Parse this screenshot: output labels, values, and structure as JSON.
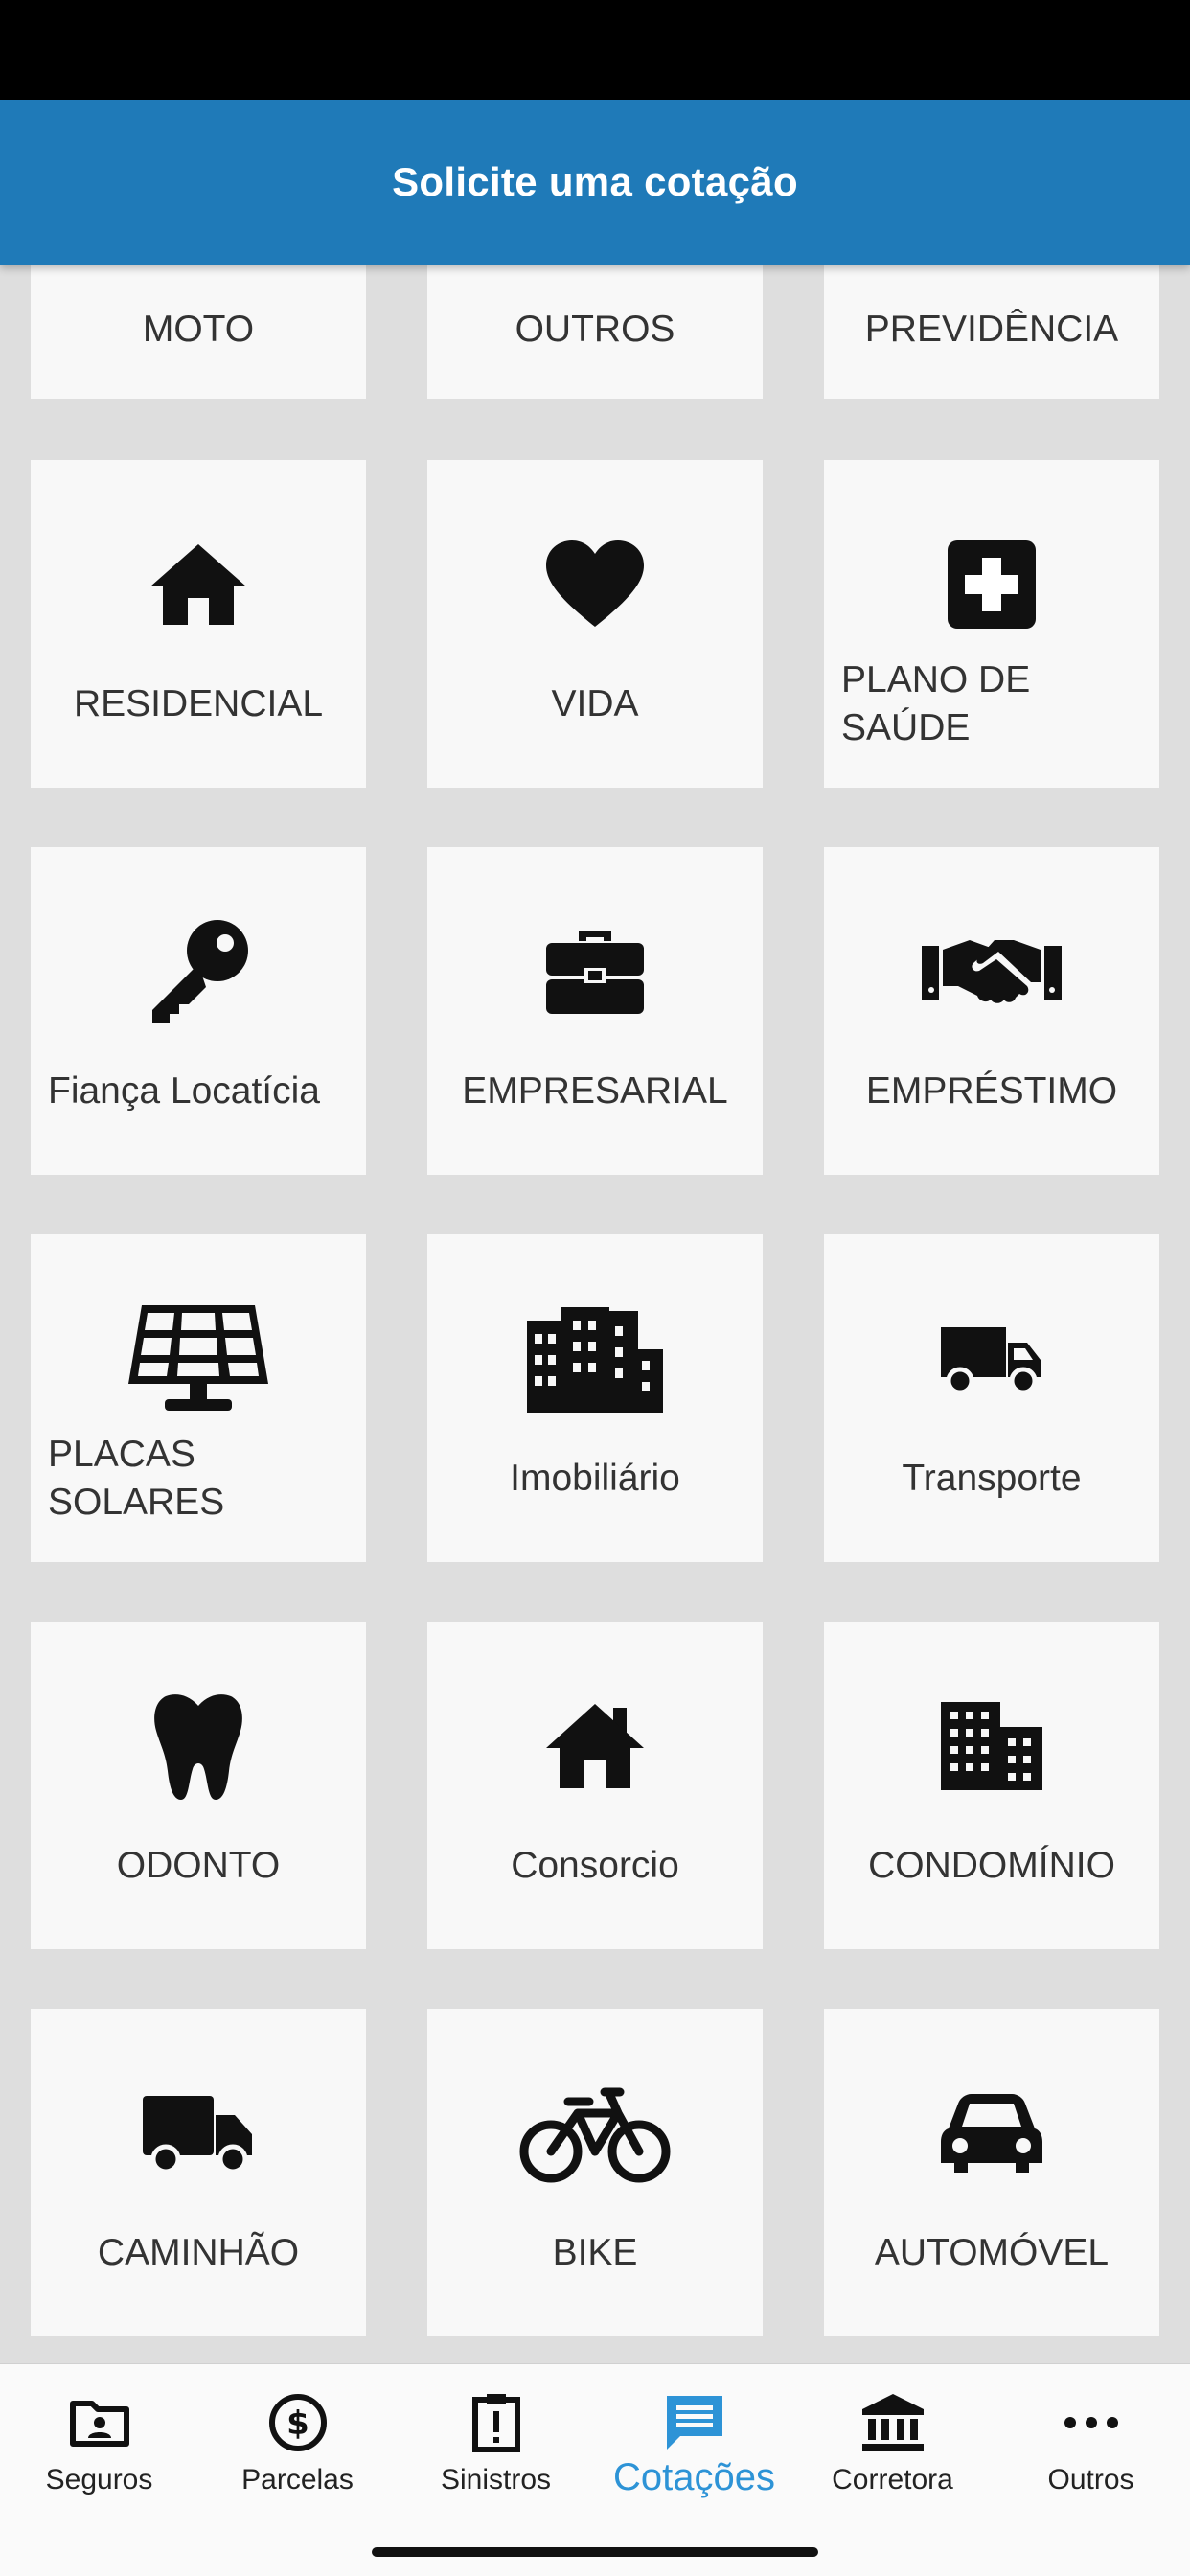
{
  "app_bar": {
    "title": "Solicite uma cotação"
  },
  "tiles": [
    {
      "label": "MOTO",
      "icon": "motorcycle-icon"
    },
    {
      "label": "OUTROS",
      "icon": ""
    },
    {
      "label": "PREVIDÊNCIA",
      "icon": ""
    },
    {
      "label": "RESIDENCIAL",
      "icon": "home-icon"
    },
    {
      "label": "VIDA",
      "icon": "heart-icon"
    },
    {
      "label": "PLANO DE SAÚDE",
      "icon": "medical-plus-icon"
    },
    {
      "label": "Fiança Locatícia",
      "icon": "key-icon"
    },
    {
      "label": "EMPRESARIAL",
      "icon": "briefcase-icon"
    },
    {
      "label": "EMPRÉSTIMO",
      "icon": "handshake-icon"
    },
    {
      "label": "PLACAS SOLARES",
      "icon": "solar-panel-icon"
    },
    {
      "label": "Imobiliário",
      "icon": "city-buildings-icon"
    },
    {
      "label": "Transporte",
      "icon": "delivery-truck-icon"
    },
    {
      "label": "ODONTO",
      "icon": "tooth-icon"
    },
    {
      "label": "Consorcio",
      "icon": "house-chimney-icon"
    },
    {
      "label": "CONDOMÍNIO",
      "icon": "building-icon"
    },
    {
      "label": "CAMINHÃO",
      "icon": "truck-icon"
    },
    {
      "label": "BIKE",
      "icon": "bicycle-icon"
    },
    {
      "label": "AUTOMÓVEL",
      "icon": "car-icon"
    }
  ],
  "bottom_nav": {
    "items": [
      {
        "label": "Seguros",
        "icon": "folder-user-icon"
      },
      {
        "label": "Parcelas",
        "icon": "dollar-circle-icon"
      },
      {
        "label": "Sinistros",
        "icon": "alert-clipboard-icon"
      },
      {
        "label": "Cotações",
        "icon": "chat-icon",
        "active": true
      },
      {
        "label": "Corretora",
        "icon": "bank-icon"
      },
      {
        "label": "Outros",
        "icon": "more-dots-icon"
      }
    ]
  },
  "colors": {
    "primary": "#1f7ab8",
    "active_tab": "#2d93d6",
    "background": "#dedede",
    "tile": "#f8f8f8"
  }
}
